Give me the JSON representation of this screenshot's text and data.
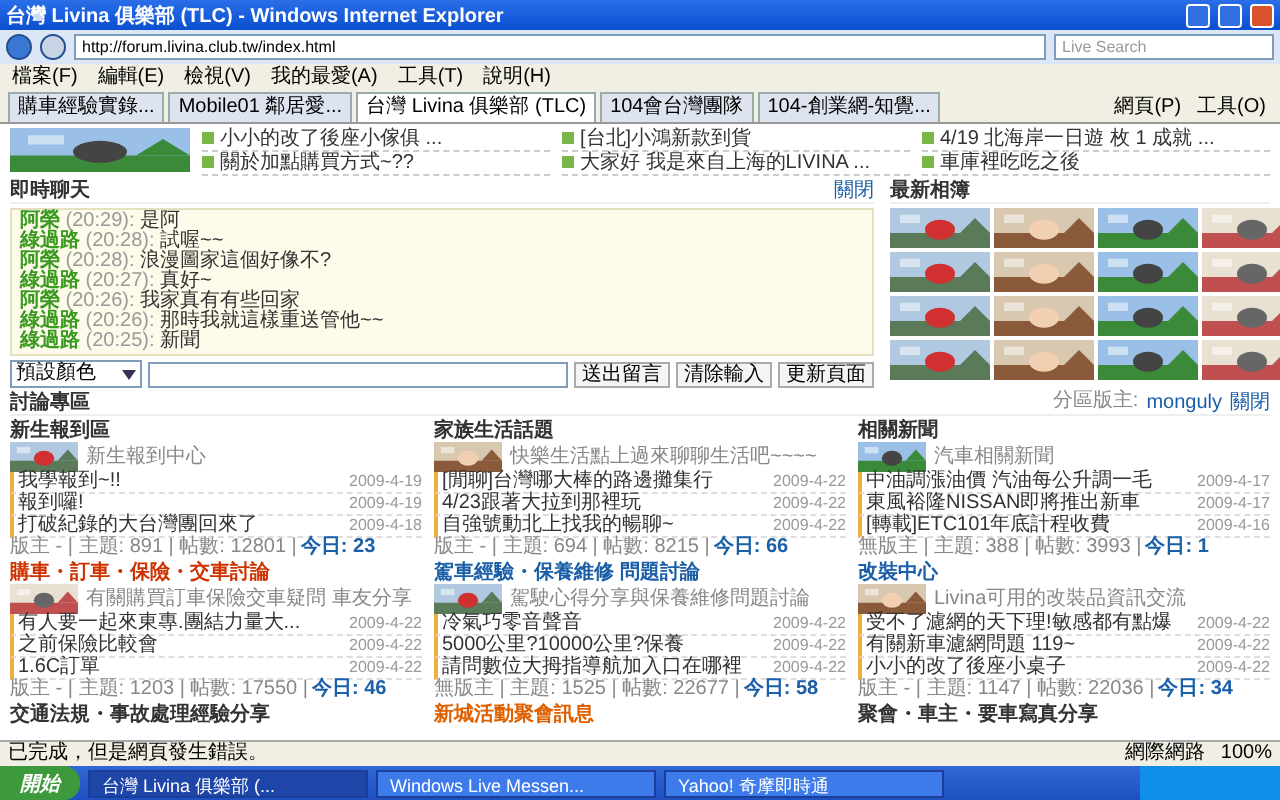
{
  "window": {
    "title": "台灣 Livina 俱樂部 (TLC) - Windows Internet Explorer"
  },
  "address_bar": {
    "url": "http://forum.livina.club.tw/index.html",
    "search_placeholder": "Live Search"
  },
  "menu": [
    "檔案(F)",
    "編輯(E)",
    "檢視(V)",
    "我的最愛(A)",
    "工具(T)",
    "說明(H)"
  ],
  "tabs": [
    {
      "label": "購車經驗實錄...",
      "selected": false
    },
    {
      "label": "Mobile01 鄰居愛...",
      "selected": false
    },
    {
      "label": "台灣 Livina 俱樂部 (TLC)",
      "selected": true
    },
    {
      "label": "104會台灣團隊",
      "selected": false
    },
    {
      "label": "104-創業網-知覺...",
      "selected": false
    }
  ],
  "toolbar_buttons": [
    "網頁(P)",
    "工具(O)"
  ],
  "page": {
    "headlines": [
      {
        "title": "小小的改了後座小傢俱 ..."
      },
      {
        "title": "[台北]小鴻新款到貨"
      },
      {
        "title": "4/19 北海岸一日遊 枚 1 成就 ..."
      },
      {
        "title": "關於加點購買方式~??"
      },
      {
        "title": "大家好 我是來自上海的LIVINA ..."
      },
      {
        "title": "車庫裡吃吃之後"
      }
    ],
    "albums": {
      "title": "最新相簿"
    },
    "chat": {
      "title": "即時聊天",
      "toggle": "關閉",
      "messages": [
        {
          "user": "阿榮",
          "time": "(20:29):",
          "text": "是阿"
        },
        {
          "user": "綠過路",
          "time": "(20:28):",
          "text": "試喔~~"
        },
        {
          "user": "阿榮",
          "time": "(20:28):",
          "text": "浪漫圖家這個好像不?"
        },
        {
          "user": "綠過路",
          "time": "(20:27):",
          "text": "真好~"
        },
        {
          "user": "阿榮",
          "time": "(20:26):",
          "text": "我家真有有些回家"
        },
        {
          "user": "綠過路",
          "time": "(20:26):",
          "text": "那時我就這樣重送管他~~"
        },
        {
          "user": "綠過路",
          "time": "(20:25):",
          "text": "新聞"
        }
      ],
      "color_select": "預設顏色",
      "buttons": [
        "送出留言",
        "清除輸入",
        "更新頁面"
      ]
    },
    "forum": {
      "title": "討論專區",
      "moderator_label": "分區版主:",
      "moderator": "monguly",
      "toggle": "關閉",
      "boards": [
        {
          "title": "新生報到區",
          "color": "#333333",
          "description": "新生報到中心",
          "posts": [
            {
              "title": "我學報到~!!",
              "date": "2009-4-19"
            },
            {
              "title": "報到囉!",
              "date": "2009-4-19"
            },
            {
              "title": "打破紀錄的大台灣團回來了",
              "date": "2009-4-18"
            }
          ],
          "stats": "版主 - | 主題: 891 | 帖數: 12801 |",
          "today": "今日: 23"
        },
        {
          "title": "家族生活話題",
          "color": "#333333",
          "description": "快樂生活點上過來聊聊生活吧~~~~",
          "posts": [
            {
              "title": "[閒聊]台灣哪大棒的路邊攤集行",
              "date": "2009-4-22"
            },
            {
              "title": "4/23跟著大拉到那裡玩",
              "date": "2009-4-22"
            },
            {
              "title": "自強號動北上找我的暢聊~",
              "date": "2009-4-22"
            }
          ],
          "stats": "版主 - | 主題: 694 | 帖數: 8215 |",
          "today": "今日: 66"
        },
        {
          "title": "相關新聞",
          "color": "#333333",
          "description": "汽車相關新聞",
          "posts": [
            {
              "title": "中油調漲油價 汽油每公升調一毛",
              "date": "2009-4-17"
            },
            {
              "title": "東風裕隆NISSAN即將推出新車",
              "date": "2009-4-17"
            },
            {
              "title": "[轉載]ETC101年底計程收費",
              "date": "2009-4-16"
            }
          ],
          "stats": "無版主 | 主題: 388 | 帖數: 3993 |",
          "today": "今日: 1"
        },
        {
          "title": "購車・訂車・保險・交車討論",
          "color": "#cc3300",
          "description": "有關購買訂車保險交車疑問 車友分享",
          "posts": [
            {
              "title": "有人要一起來東專.團結力量大...",
              "date": "2009-4-22"
            },
            {
              "title": "之前保險比較會",
              "date": "2009-4-22"
            },
            {
              "title": "1.6C訂單",
              "date": "2009-4-22"
            }
          ],
          "stats": "版主 - | 主題: 1203 | 帖數: 17550 |",
          "today": "今日: 46"
        },
        {
          "title": "駕車經驗・保養維修 問題討論",
          "color": "#1a5fa8",
          "description": "駕駛心得分享與保養維修問題討論",
          "posts": [
            {
              "title": "冷氣巧零音聲音",
              "date": "2009-4-22"
            },
            {
              "title": "5000公里?10000公里?保養",
              "date": "2009-4-22"
            },
            {
              "title": "請問數位大拇指導航加入口在哪裡",
              "date": "2009-4-22"
            }
          ],
          "stats": "無版主 | 主題: 1525 | 帖數: 22677 |",
          "today": "今日: 58"
        },
        {
          "title": "改裝中心",
          "color": "#1a5fa8",
          "description": "Livina可用的改裝品資訊交流",
          "posts": [
            {
              "title": "受不了濾網的天下理!敏感都有點爆",
              "date": "2009-4-22"
            },
            {
              "title": "有關新車濾網問題 119~",
              "date": "2009-4-22"
            },
            {
              "title": "小小的改了後座小桌子",
              "date": "2009-4-22"
            }
          ],
          "stats": "版主 - | 主題: 1147 | 帖數: 22036 |",
          "today": "今日: 34"
        },
        {
          "title": "交通法規・事故處理經驗分享",
          "color": "#333333"
        },
        {
          "title": "新城活動聚會訊息",
          "color": "#e06000"
        },
        {
          "title": "聚會・車主・要車寫真分享",
          "color": "#333333"
        }
      ]
    }
  },
  "status_bar": {
    "text": "已完成，但是網頁發生錯誤。",
    "zone": "網際網路",
    "zoom": "100%"
  },
  "taskbar": {
    "start": "開始",
    "items": [
      {
        "label": "台灣 Livina 俱樂部 (...",
        "selected": true
      },
      {
        "label": "Windows Live Messen...",
        "selected": false
      },
      {
        "label": "Yahoo! 奇摩即時通",
        "selected": false
      }
    ]
  }
}
